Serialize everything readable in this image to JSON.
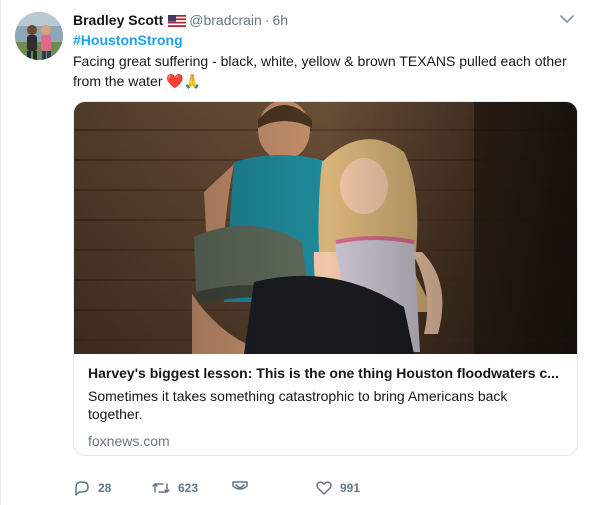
{
  "tweet": {
    "author_name": "Bradley Scott",
    "handle": "@bradcrain",
    "separator": "·",
    "time": "6h",
    "hashtag": "#HoustonStrong",
    "text": "Facing great suffering - black, white, yellow & brown TEXANS pulled each other from the water ❤️🙏",
    "emoji": [
      "red-heart",
      "folded-hands"
    ]
  },
  "card": {
    "title": "Harvey's biggest lesson: This is the one thing Houston floodwaters c...",
    "description": "Sometimes it takes something catastrophic to bring Americans back together.",
    "domain": "foxnews.com"
  },
  "actions": {
    "replies": "28",
    "retweets": "623",
    "likes": "991"
  },
  "icons": {
    "flag": "us-flag-icon",
    "caret": "chevron-down-icon",
    "reply": "reply-icon",
    "retweet": "retweet-icon",
    "dm": "direct-message-icon",
    "like": "heart-icon"
  },
  "colors": {
    "link_blue": "#1da1f2",
    "secondary_text": "#657786",
    "border": "#e1e8ed",
    "heart_red": "#cc1122"
  }
}
